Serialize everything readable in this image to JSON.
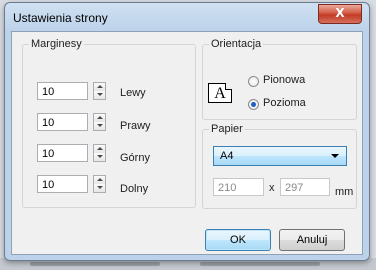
{
  "window": {
    "title": "Ustawienia strony",
    "close_glyph": "X"
  },
  "margins": {
    "legend": "Marginesy",
    "rows": [
      {
        "value": "10",
        "label": "Lewy"
      },
      {
        "value": "10",
        "label": "Prawy"
      },
      {
        "value": "10",
        "label": "Górny"
      },
      {
        "value": "10",
        "label": "Dolny"
      }
    ]
  },
  "orientation": {
    "legend": "Orientacja",
    "icon_glyph": "A",
    "options": [
      {
        "label": "Pionowa",
        "selected": false
      },
      {
        "label": "Pozioma",
        "selected": true
      }
    ]
  },
  "paper": {
    "legend": "Papier",
    "selected": "A4",
    "width": "210",
    "times": "x",
    "height": "297",
    "unit": "mm"
  },
  "buttons": {
    "ok": "OK",
    "cancel": "Anuluj"
  },
  "colors": {
    "accent": "#3c7fb1",
    "close": "#c23b24"
  }
}
